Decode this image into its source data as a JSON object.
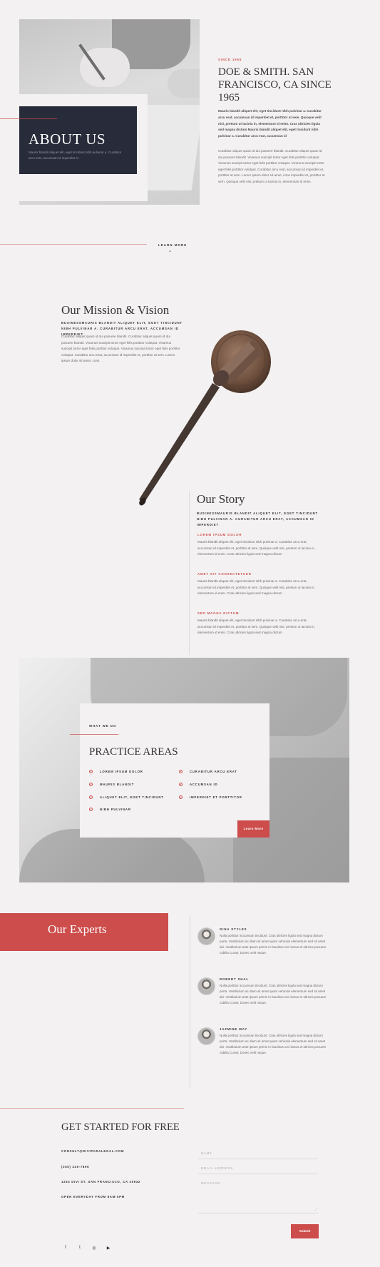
{
  "hero": {
    "about_title": "ABOUT US",
    "about_text": "Mauris blandit aliquet elit, eget tincidunt nibh pulvinar a. Curabitur arcu erat, accumsan id imperdiet et",
    "since_label": "SINCE 1965",
    "headline": "DOE & SMITH. SAN FRANCISCO, CA SINCE 1965",
    "bold_text": "Mauris blandit aliquet elit, eget tincidunt nibh pulvinar a. Curabitur arcu erat, accumsan id imperdiet et, porttitor at sem. Quisque velit nisi, pretium ut lacinia in, elementum id enim. Cras ultricies ligula sed magna dictum Mauris blandit aliquet elit, eget tincidunt nibh pulvinar a. Curabitur arcu erat, accumsan id",
    "paragraph": "Curabitur aliquet quam id dui posuere blandit. Curabitur aliquet quam id dui posuere blandit. Vivamus suscipit tortor eget felis porttitor volutpat. Vivamus suscipit tortor eget felis porttitor volutpat. Vivamus suscipit tortor eget felis porttitor volutpat. Curabitur arcu erat, accumsan id imperdiet et, porttitor at sem. Lorem ipsum dolor sit amet, cons imperdiet et, porttitor at sem. Quisque velit nisi, pretium ut lacinia in, elementum id enim."
  },
  "learn_more": {
    "label": "LEARN MORE",
    "chevron": "⌄"
  },
  "mission": {
    "title": "Our Mission & Vision",
    "subtitle": "BUSINESSMAURIS BLANDIT ALIQUET ELIT, EGET TINCIDUNT NIBH PULVINAR A. CURABITUR ARCU ERAT, ACCUMSAN ID IMPERDIET",
    "paragraph": "Curabitur aliquet quam id dui posuere blandit. Curabitur aliquet quam id dui posuere blandit. Vivamus suscipit tortor eget felis porttitor volutpat. Vivamus suscipit tortor eget felis porttitor volutpat. Vivamus suscipit tortor eget felis porttitor volutpat. Curabitur arcu erat, accumsan id imperdiet et, porttitor at sem. Lorem ipsum dolor sit amet, cons"
  },
  "story": {
    "title": "Our Story",
    "subtitle": "BUSINESSMAURIS BLANDIT ALIQUET ELIT, EGET TINCIDUNT NIBH PULVINAR A. CURABITUR ARCU ERAT, ACCUMSAN ID IMPERDIET",
    "sections": [
      {
        "heading": "LOREM IPSUM DOLOR",
        "text": "Mauris blandit aliquet elit, eget tincidunt nibh pulvinar a. Curabitur arcu erat, accumsan id imperdiet et, porttitor at sem. Quisque velit nisi, pretium ut lacinia in, elementum id enim. Cras ultricies ligula sed magna dictum"
      },
      {
        "heading": "AMET SIT CONSECTETUER",
        "text": "Mauris blandit aliquet elit, eget tincidunt nibh pulvinar a. Curabitur arcu erat, accumsan id imperdiet et, porttitor at sem. Quisque velit nisi, pretium ut lacinia in, elementum id enim. Cras ultricies ligula sed magna dictum"
      },
      {
        "heading": "SED MAGNA DICTUM",
        "text": "Mauris blandit aliquet elit, eget tincidunt nibh pulvinar a. Curabitur arcu erat, accumsan id imperdiet et, porttitor at sem. Quisque velit nisi, pretium ut lacinia in, elementum id enim. Cras ultricies ligula sed magna dictum"
      }
    ]
  },
  "practice": {
    "eyebrow": "WHAT WE DO",
    "title": "PRACTICE AREAS",
    "items_left": [
      "LOREM IPSUM DOLOR",
      "MAURIS BLANDIT",
      "ALIQUET ELIT, EGET TINCIDUNT",
      "NIBH PULVINAR"
    ],
    "items_right": [
      "CURABITUR ARCU ERAT",
      "ACCUMSAN ID",
      "IMPERDIET ET PORTTITOR"
    ],
    "button": "Learn More"
  },
  "experts": {
    "title": "Our Experts",
    "people": [
      {
        "name": "GINA STYLES",
        "bio": "Nulla porttitor accumsan tincidunt. Cras ultricies ligula sed magna dictum porta. Vestibulum ac diam sit amet quam vehicula elementum sed sit amet dui. Vestibulum ante ipsum primis in faucibus orci luctus et ultrices posuere cubilia Curae; Donec velit neque."
      },
      {
        "name": "ROBERT SHAL",
        "bio": "Nulla porttitor accumsan tincidunt. Cras ultricies ligula sed magna dictum porta. Vestibulum ac diam sit amet quam vehicula elementum sed sit amet dui. Vestibulum ante ipsum primis in faucibus orci luctus et ultrices posuere cubilia Curae; Donec velit neque."
      },
      {
        "name": "JAZMINE MAY",
        "bio": "Nulla porttitor accumsan tincidunt. Cras ultricies ligula sed magna dictum porta. Vestibulum ac diam sit amet quam vehicula elementum sed sit amet dui. Vestibulum ante ipsum primis in faucibus orci luctus et ultrices posuere cubilia Curae; Donec velit neque."
      }
    ]
  },
  "contact": {
    "title": "GET STARTED FOR  FREE",
    "email": "CONSULT@DIVIPARALEGAL.COM",
    "phone": "(255) 325-7896",
    "address": "1234 DIVI ST. SAN FRANCISCO, CA 25932",
    "hours": "OPEN EVERYDAY FROM 8AM-5PM",
    "form": {
      "name_placeholder": "NAME",
      "email_placeholder": "EMAIL ADDRESS",
      "message_placeholder": "MESSAGE",
      "submit": "Submit"
    }
  },
  "social": [
    "f",
    "t",
    "◎",
    "▶"
  ],
  "colors": {
    "accent": "#cc4d4b",
    "navy": "#272b3a",
    "background": "#f3f1f1"
  }
}
